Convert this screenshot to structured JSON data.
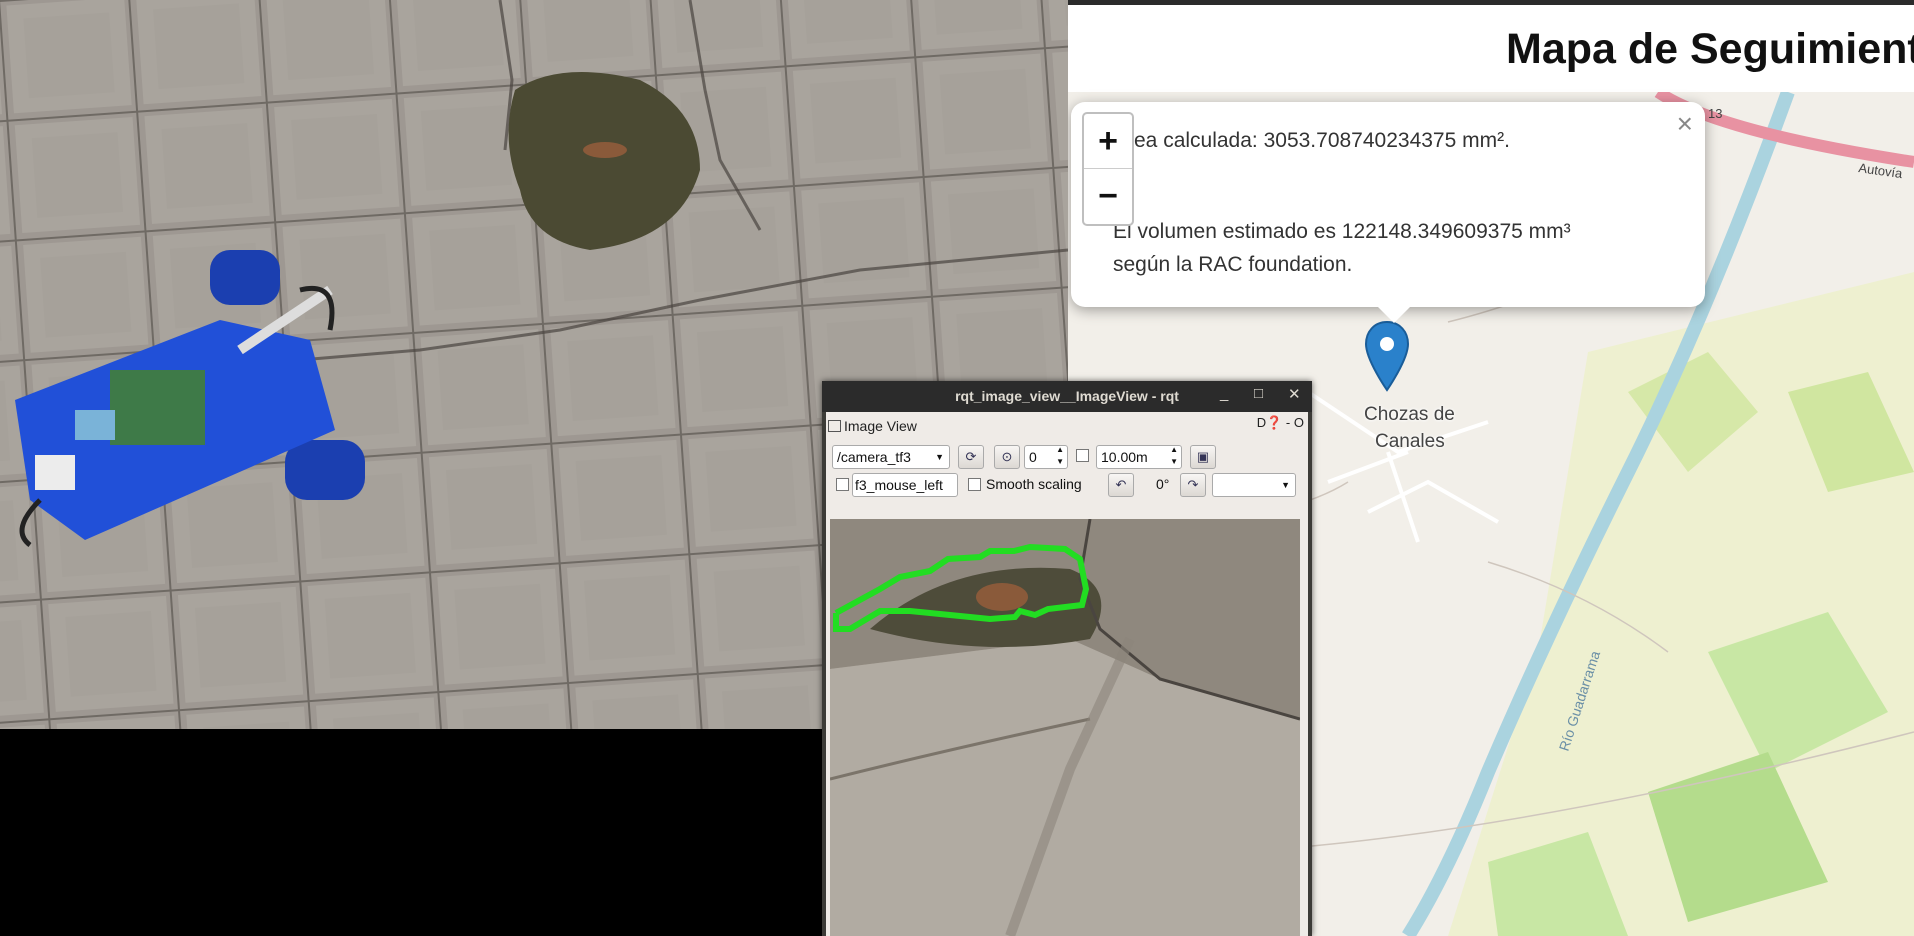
{
  "map": {
    "title": "Mapa de Seguimiento",
    "zoom_in": "+",
    "zoom_out": "−",
    "popup": {
      "line1": "Área calculada: 3053.708740234375 mm².",
      "line2": "El volumen estimado es 122148.349609375 mm³",
      "line3": "según la RAC foundation.",
      "close": "×"
    },
    "place": [
      "Chozas de",
      "Canales"
    ],
    "road_ref": "13",
    "road_name": "Autovía",
    "river": "Río Guadarrama",
    "colors": {
      "pin": "#2a81cb",
      "river": "#aad3df",
      "road": "#e892a2",
      "green": "#c8e7a4"
    }
  },
  "rqt": {
    "window_title": "rqt_image_view__ImageView - rqt",
    "minimize": "_",
    "maximize": "□",
    "close": "✕",
    "dock_title": "Image View",
    "dock_buttons": "D❓  -  O",
    "topic": "/camera_tf3",
    "refresh_icon": "refresh-icon",
    "spin_value": "0",
    "max_range": "10.00m",
    "mouse_topic": "f3_mouse_left",
    "smooth_scaling": "Smooth scaling",
    "rotation": "0°",
    "contour_color": "#22dd22"
  }
}
